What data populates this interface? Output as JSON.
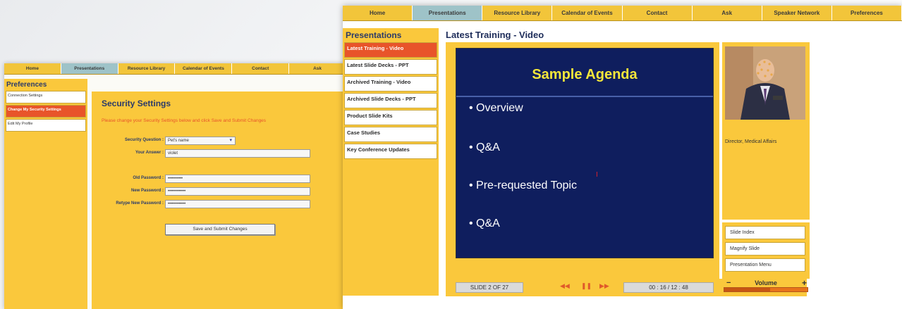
{
  "back_window": {
    "nav": [
      "Home",
      "Presentations",
      "Resource Library",
      "Calendar of Events",
      "Contact",
      "Ask"
    ],
    "active_nav": "Presentations",
    "sidebar": {
      "title": "Preferences",
      "items": [
        "Connection Settings",
        "Change My Security Settings",
        "Edit My Profile"
      ],
      "selected": "Change My Security Settings"
    },
    "security": {
      "title": "Security Settings",
      "note": "Please change your Security Settings below and click Save and Submit Changes",
      "question_label": "Security Question :",
      "question_value": "Pet's name",
      "answer_label": "Your Answer :",
      "answer_value": "violet",
      "old_pw_label": "Old Password :",
      "old_pw_value": "••••••••••",
      "new_pw_label": "New Password :",
      "new_pw_value": "••••••••••••",
      "retype_pw_label": "Retype New Password :",
      "retype_pw_value": "••••••••••••",
      "submit_label": "Save and Submit Changes"
    }
  },
  "front_window": {
    "nav": [
      "Home",
      "Presentations",
      "Resource Library",
      "Calendar of Events",
      "Contact",
      "Ask",
      "Speaker Network",
      "Preferences"
    ],
    "active_nav": "Presentations",
    "sidebar": {
      "title": "Presentations",
      "items": [
        "Latest Training - Video",
        "Latest Slide Decks - PPT",
        "Archived Training - Video",
        "Archived Slide Decks - PPT",
        "Product Slide Kits",
        "Case Studies",
        "Key Conference Updates"
      ],
      "selected": "Latest Training - Video"
    },
    "page_title": "Latest Training - Video",
    "slide": {
      "title": "Sample Agenda",
      "bullets": [
        "Overview",
        "Q&A",
        "Pre-requested Topic",
        "Q&A"
      ]
    },
    "speaker": {
      "role": "Director, Medical Affairs"
    },
    "options": [
      "Slide Index",
      "Magnify Slide",
      "Presentation Menu"
    ],
    "controls": {
      "slide_counter": "SLIDE 2 OF 27",
      "time": "00 : 16 / 12 : 48",
      "volume_label": "Volume",
      "volume_minus": "−",
      "volume_plus": "+",
      "volume_level": 0.55
    },
    "colors": {
      "panel": "#fac83c",
      "accent": "#e8542a",
      "slide_bg": "#0f1e5e",
      "slide_title": "#f3e63a",
      "active_tab": "#9ec3c8"
    }
  }
}
